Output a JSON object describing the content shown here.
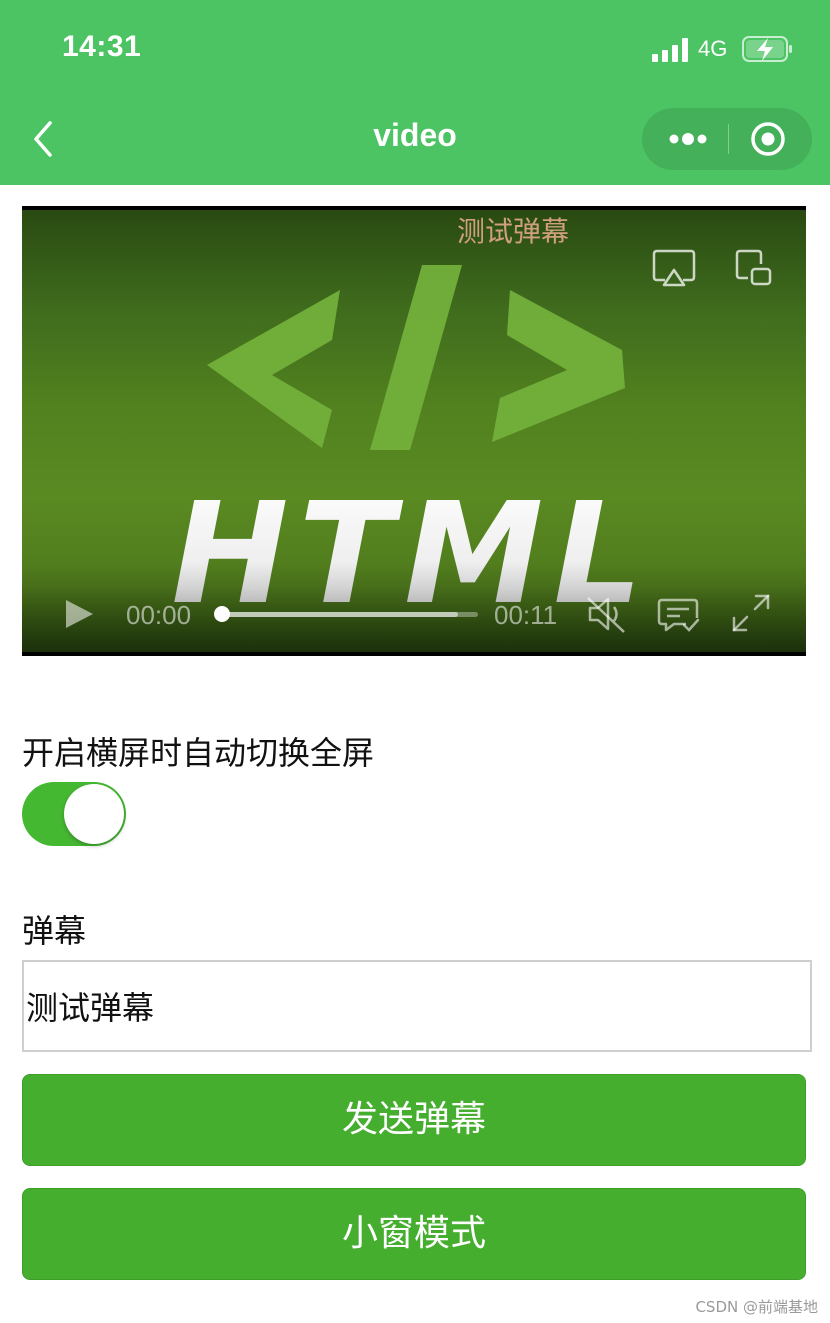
{
  "status_bar": {
    "time": "14:31",
    "network": "4G"
  },
  "nav": {
    "title": "video"
  },
  "video": {
    "danmaku_text": "测试弹幕",
    "poster_text": "HTML",
    "current_time": "00:00",
    "duration": "00:11",
    "progress": 0,
    "buffered": 0.92
  },
  "form": {
    "auto_fullscreen_label": "开启横屏时自动切换全屏",
    "auto_fullscreen_on": true,
    "danmu_label": "弹幕",
    "danmu_input_value": "测试弹幕",
    "send_button": "发送弹幕",
    "pip_button": "小窗模式"
  },
  "watermark": "CSDN @前端基地",
  "colors": {
    "brand_green": "#4cc464",
    "button_green": "#46ae2f",
    "switch_green": "#45b832"
  }
}
